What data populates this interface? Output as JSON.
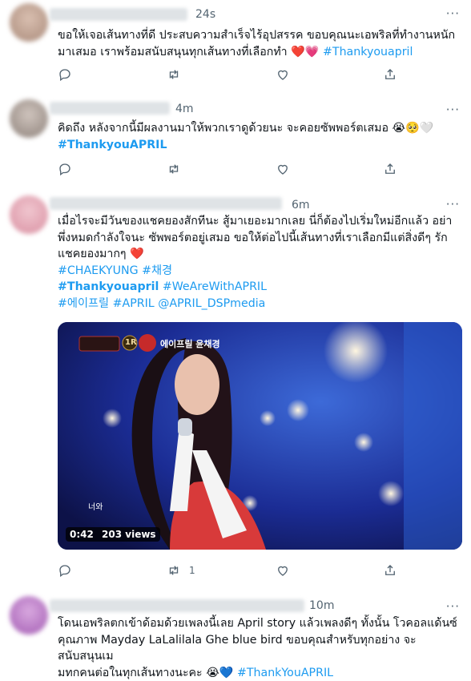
{
  "tweets": [
    {
      "time": "24s",
      "lines": [
        "ขอให้เจอเส้นทางที่ดี ประสบความสำเร็จไร้อุปสรรค ขอบคุณนะเอพริลที่ทำงานหนัก",
        "มาเสมอ เราพร้อมสนับสนุนทุกเส้นทางที่เลือกทำ"
      ],
      "hashtag": "#Thankyouapril",
      "emoji_tail": "❤️💗"
    },
    {
      "time": "4m",
      "line1": "คิดถึง หลังจากนี้มีผลงานมาให้พวกเราดูด้วยนะ จะคอยซัพพอร์ตเสมอ",
      "emoji_tail": "😭🥺🤍",
      "hashtag": "#ThankyouAPRIL"
    },
    {
      "time": "6m",
      "lines": [
        "เมื่อไรจะมีวันของแชคยองสักทีนะ สู้มาเยอะมากเลย นี่ก็ต้องไปเริ่มใหม่อีกแล้ว อย่า",
        "พึ่งหมดกำลังใจนะ ซัพพอร์ตอยู่เสมอ ขอให้ต่อไปนี้เส้นทางที่เราเลือกมีแต่สิ่งดีๆ รัก",
        "แชคยองมากๆ"
      ],
      "heart": "❤️",
      "tags_line1": "#CHAEKYUNG #채경",
      "tags_line2_bold": "#Thankyouapril",
      "tags_line2_rest": " #WeAreWithAPRIL",
      "tags_line3": "#에이프릴 #APRIL @APRIL_DSPmedia",
      "video_time": "0:42",
      "video_views": "203 views",
      "retweet_count": "1",
      "overlay_label": "에이프릴 윤채경",
      "overlay_round": "1R",
      "caption": "너와"
    },
    {
      "time": "10m",
      "lines": [
        "โดนเอพริลตกเข้าด้อมด้วยเพลงนี้เลย April story แล้วเพลงดีๆ ทั้งนั้น โวคอลแด้นซ์",
        "คุณภาพ Mayday LaLalilala Ghe blue bird ขอบคุณสำหรับทุกอย่าง จะสนับสนุนเม",
        "มทกคนต่อในทุกเส้นทางนะคะ"
      ],
      "emoji_tail": "😭💙",
      "hashtag": "#ThankYouAPRIL"
    }
  ],
  "more_icon": "more-dots-icon",
  "colors": {
    "link": "#1d9bf0",
    "muted": "#536471",
    "divider": "#eff3f4"
  }
}
